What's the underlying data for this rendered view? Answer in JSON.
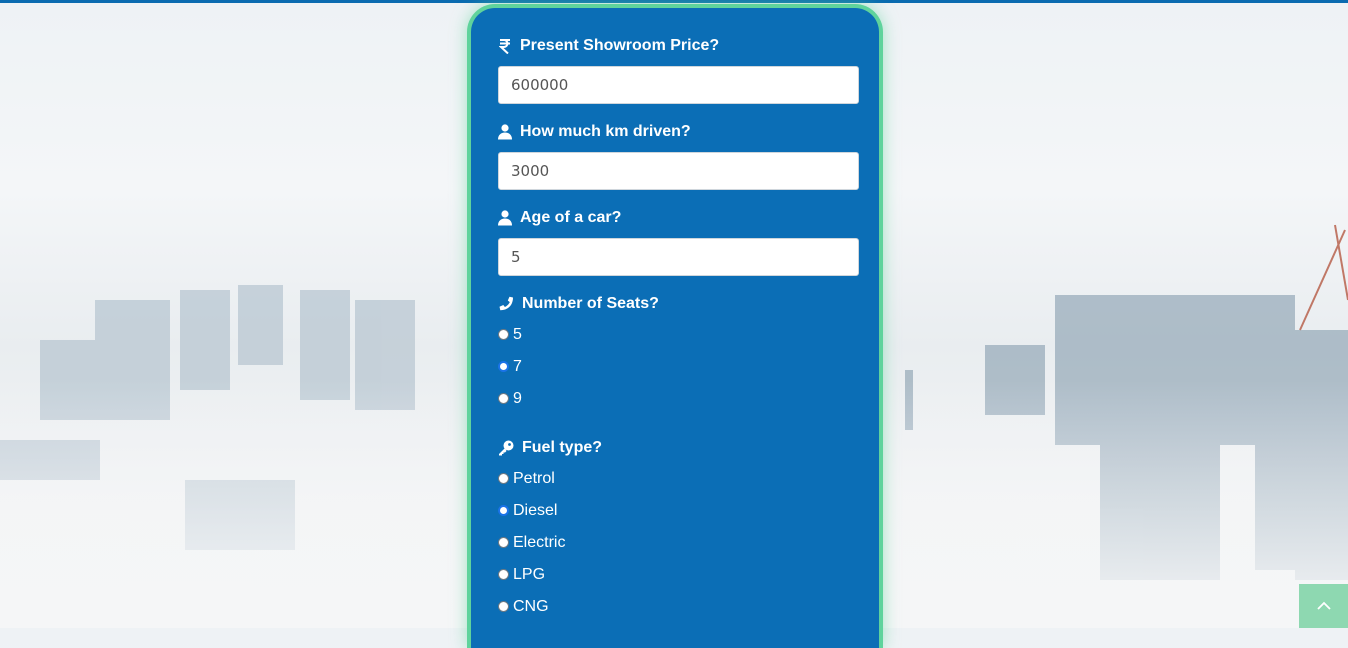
{
  "colors": {
    "accent": "#0b6eb6",
    "card_border": "#5fd39c",
    "scroll_button": "#8ed8b1",
    "top_bar": "#0a6bb0"
  },
  "form": {
    "price": {
      "icon": "rupee-icon",
      "label": "Present Showroom Price?",
      "value": "600000"
    },
    "km": {
      "icon": "user-icon",
      "label": "How much km driven?",
      "value": "3000"
    },
    "age": {
      "icon": "user-icon",
      "label": "Age of a car?",
      "value": "5"
    },
    "seats": {
      "icon": "phone-icon",
      "label": "Number of Seats?",
      "options": [
        {
          "label": "5",
          "focused": false
        },
        {
          "label": "7",
          "focused": true
        },
        {
          "label": "9",
          "focused": false
        }
      ]
    },
    "fuel": {
      "icon": "key-icon",
      "label": "Fuel type?",
      "options": [
        {
          "label": "Petrol",
          "focused": false
        },
        {
          "label": "Diesel",
          "focused": true
        },
        {
          "label": "Electric",
          "focused": false
        },
        {
          "label": "LPG",
          "focused": false
        },
        {
          "label": "CNG",
          "focused": false
        }
      ]
    }
  },
  "scroll_top": {
    "icon": "chevron-up-icon"
  }
}
